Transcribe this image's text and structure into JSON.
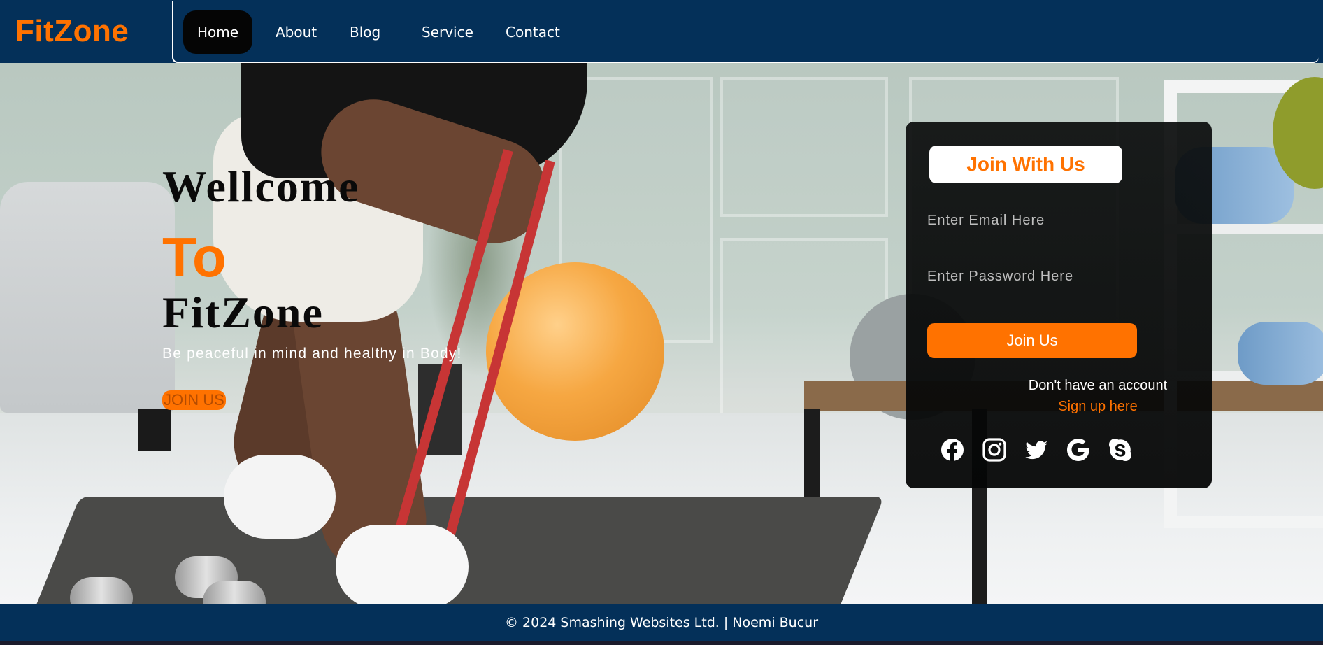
{
  "brand": {
    "logo_text": "FitZone",
    "accent_color": "#ff7200",
    "nav_bg_color": "#043059"
  },
  "nav": {
    "items": [
      {
        "label": "Home",
        "active": true
      },
      {
        "label": "About",
        "active": false
      },
      {
        "label": "Blog",
        "active": false
      },
      {
        "label": "Service",
        "active": false
      },
      {
        "label": "Contact",
        "active": false
      }
    ]
  },
  "hero": {
    "line1": "Wellcome",
    "line2": "To",
    "line3": "FitZone",
    "tagline": "Be peaceful in mind and healthy in Body!",
    "cta_label": "JOIN US"
  },
  "form": {
    "title": "Join With Us",
    "email_placeholder": "Enter Email Here",
    "password_placeholder": "Enter Password Here",
    "submit_label": "Join Us",
    "no_account_text": "Don't have an account",
    "signup_link": "Sign up here",
    "social_icons": [
      "facebook-icon",
      "instagram-icon",
      "twitter-icon",
      "google-icon",
      "skype-icon"
    ]
  },
  "footer": {
    "text": "© 2024 Smashing Websites Ltd. | Noemi Bucur"
  }
}
